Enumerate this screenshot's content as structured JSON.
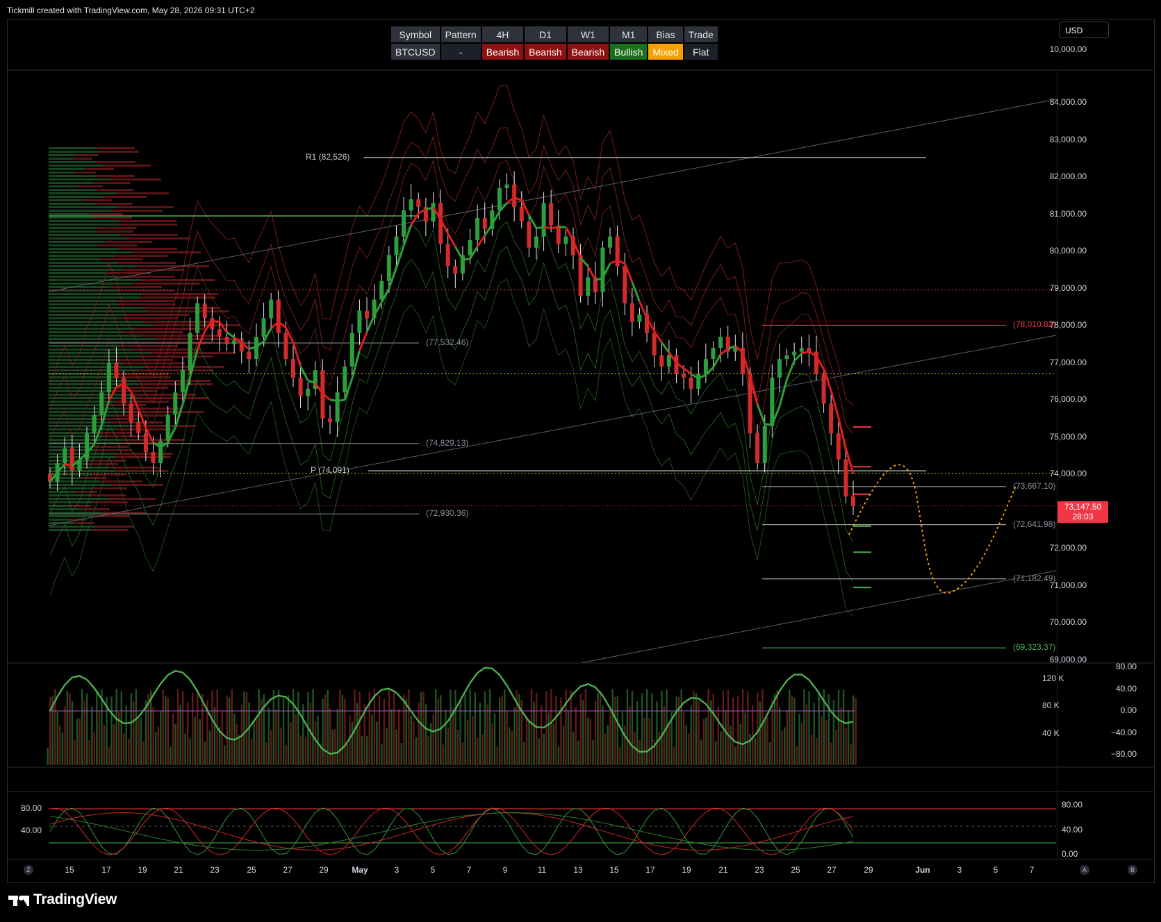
{
  "header": {
    "credit": "Tickmill created with TradingView.com, May 28, 2026 09:31 UTC+2"
  },
  "currency_button": "USD",
  "signal_table": {
    "headers": [
      "Symbol",
      "Pattern",
      "4H",
      "D1",
      "W1",
      "M1",
      "Bias",
      "Trade"
    ],
    "values": [
      {
        "text": "BTCUSD",
        "kind": "sym"
      },
      {
        "text": "-",
        "kind": "dash"
      },
      {
        "text": "Bearish",
        "kind": "bear"
      },
      {
        "text": "Bearish",
        "kind": "bear"
      },
      {
        "text": "Bearish",
        "kind": "bear"
      },
      {
        "text": "Bullish",
        "kind": "bull"
      },
      {
        "text": "Mixed",
        "kind": "mixed"
      },
      {
        "text": "Flat",
        "kind": "flat"
      }
    ]
  },
  "price_tag": {
    "price": "73,147.50",
    "countdown": "28:03"
  },
  "footer": {
    "logo": "TradingView",
    "left_circle": "Z",
    "right_circles": [
      "A",
      "B"
    ]
  },
  "colors": {
    "bull": "#2e7d32",
    "bear": "#c62828",
    "level_red": "#f23645",
    "level_green": "#4caf50",
    "projection": "#f59f00"
  },
  "chart_data": {
    "type": "candlestick",
    "title": "",
    "price_axis": {
      "ylim": [
        69000,
        84300
      ],
      "ticks": [
        "84,000.00",
        "83,000.00",
        "82,000.00",
        "81,000.00",
        "80,000.00",
        "79,000.00",
        "78,000.00",
        "77,000.00",
        "76,000.00",
        "75,000.00",
        "74,000.00",
        "72,000.00",
        "71,000.00",
        "70,000.00",
        "69,000.00"
      ],
      "extra_label": "10,000.00"
    },
    "x_axis": {
      "ticks": [
        "15",
        "17",
        "19",
        "21",
        "23",
        "25",
        "27",
        "29",
        "May",
        "3",
        "5",
        "7",
        "9",
        "11",
        "13",
        "15",
        "17",
        "19",
        "21",
        "23",
        "25",
        "27",
        "29",
        "Jun",
        "3",
        "5",
        "7"
      ]
    },
    "close_series": [
      73800,
      74300,
      74700,
      74100,
      74400,
      75100,
      75600,
      76200,
      77000,
      76600,
      75900,
      75400,
      75100,
      74600,
      74300,
      74900,
      75600,
      76200,
      76800,
      77800,
      78600,
      78200,
      77900,
      77700,
      77500,
      77600,
      77300,
      77100,
      77700,
      78200,
      78700,
      77800,
      77100,
      76600,
      76100,
      76300,
      76800,
      75500,
      75400,
      76200,
      76900,
      77800,
      78400,
      78200,
      78700,
      79200,
      79900,
      80400,
      81100,
      81400,
      81200,
      80800,
      81300,
      80200,
      79600,
      79400,
      79900,
      80300,
      80900,
      80600,
      81100,
      81700,
      81800,
      81200,
      80800,
      80100,
      80400,
      81300,
      80700,
      80200,
      80400,
      79900,
      78800,
      79300,
      78900,
      80100,
      80400,
      79600,
      78600,
      78100,
      78300,
      77800,
      77200,
      76900,
      77200,
      76700,
      76600,
      76300,
      76700,
      77100,
      77400,
      77700,
      77300,
      77400,
      76700,
      75100,
      74300,
      75300,
      76600,
      77100,
      77200,
      77300,
      77400,
      77300,
      76700,
      75900,
      75100,
      74400,
      73400,
      73147.5
    ],
    "levels": [
      {
        "label": "R1 (82,526)",
        "value": 82526
      },
      {
        "label": "(77,532.46)",
        "value": 77532.46
      },
      {
        "label": "(74,829.13)",
        "value": 74829.13
      },
      {
        "label": "P (74,091)",
        "value": 74091
      },
      {
        "label": "(72,930.36)",
        "value": 72930.36
      },
      {
        "label": "(78,010.82)",
        "value": 78010.82
      },
      {
        "label": "(73,667.10)",
        "value": 73667.1
      },
      {
        "label": "(72,641.98)",
        "value": 72641.98
      },
      {
        "label": "(71,182.49)",
        "value": 71182.49
      },
      {
        "label": "(69,323.37)",
        "value": 69323.37
      }
    ],
    "volume_axis": {
      "ticks": [
        "120 K",
        "80 K",
        "40 K"
      ]
    },
    "oscillator_axis": {
      "ticks": [
        "80.00",
        "40.00",
        "0.00",
        "−40.00",
        "−80.00"
      ]
    },
    "stoch_axis": {
      "left_ticks": [
        "80.00",
        "40.00"
      ],
      "right_ticks": [
        "80.00",
        "40.00",
        "0.00"
      ]
    }
  }
}
